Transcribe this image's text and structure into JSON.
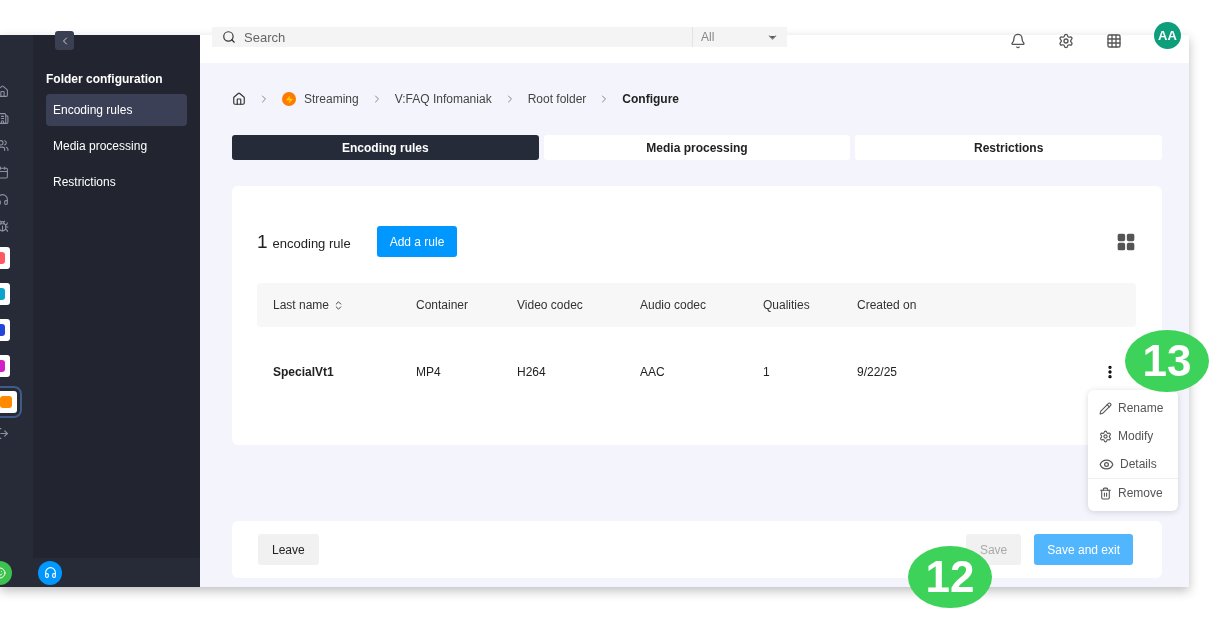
{
  "header": {
    "search": {
      "placeholder": "Search"
    },
    "scope": "All",
    "avatar": "AA"
  },
  "rail": {
    "apps": [
      {
        "color": "#ff5a5f",
        "selected": false
      },
      {
        "color": "#0aa5c8",
        "selected": false
      },
      {
        "color": "#2346d8",
        "selected": false
      },
      {
        "color": "#d21fc8",
        "selected": false
      },
      {
        "color": "#ff8a00",
        "selected": true
      }
    ]
  },
  "sidebar": {
    "title": "Folder configuration",
    "items": [
      {
        "label": "Encoding rules",
        "selected": true
      },
      {
        "label": "Media processing",
        "selected": false
      },
      {
        "label": "Restrictions",
        "selected": false
      }
    ]
  },
  "breadcrumb": [
    "Streaming",
    "V:FAQ Infomaniak",
    "Root folder",
    "Configure"
  ],
  "tabs": [
    {
      "label": "Encoding rules",
      "selected": true
    },
    {
      "label": "Media processing",
      "selected": false
    },
    {
      "label": "Restrictions",
      "selected": false
    }
  ],
  "rules": {
    "count": "1",
    "count_label": "encoding rule",
    "add_button": "Add a rule",
    "columns": [
      "Last name",
      "Container",
      "Video codec",
      "Audio codec",
      "Qualities",
      "Created on"
    ],
    "rows": [
      [
        "SpecialVt1",
        "MP4",
        "H264",
        "AAC",
        "1",
        "9/22/25"
      ]
    ]
  },
  "menu": [
    {
      "kind": "rename",
      "label": "Rename"
    },
    {
      "kind": "modify",
      "label": "Modify"
    },
    {
      "kind": "details",
      "label": "Details"
    },
    {
      "kind": "remove",
      "label": "Remove"
    }
  ],
  "footer": {
    "leave": "Leave",
    "save": {
      "label": "Save",
      "disabled": true
    },
    "save_exit": "Save and exit"
  },
  "callouts": [
    "13",
    "12"
  ]
}
